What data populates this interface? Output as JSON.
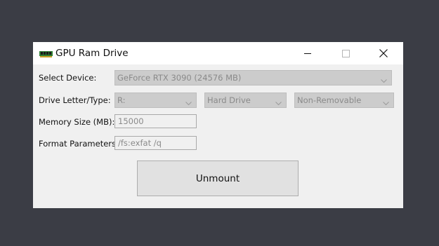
{
  "window": {
    "title": "GPU Ram Drive",
    "icon": "ram-chip-icon",
    "controls": [
      "minimize-icon",
      "maximize-icon",
      "close-icon"
    ]
  },
  "form": {
    "device_label": "Select Device:",
    "device_value": "GeForce RTX 3090 (24576 MB)",
    "drive_label": "Drive Letter/Type:",
    "drive_letter": "R:",
    "drive_type": "Hard Drive",
    "removable": "Non-Removable",
    "memory_label": "Memory Size (MB):",
    "memory_value": "15000",
    "format_label": "Format Parameters:",
    "format_value": "/fs:exfat /q"
  },
  "actions": {
    "unmount_label": "Unmount"
  },
  "colors": {
    "desktop": "#3b3d45",
    "window_bg": "#f0f0f0",
    "disabled_combo": "#cccccc",
    "disabled_text": "#8a8a8a"
  }
}
